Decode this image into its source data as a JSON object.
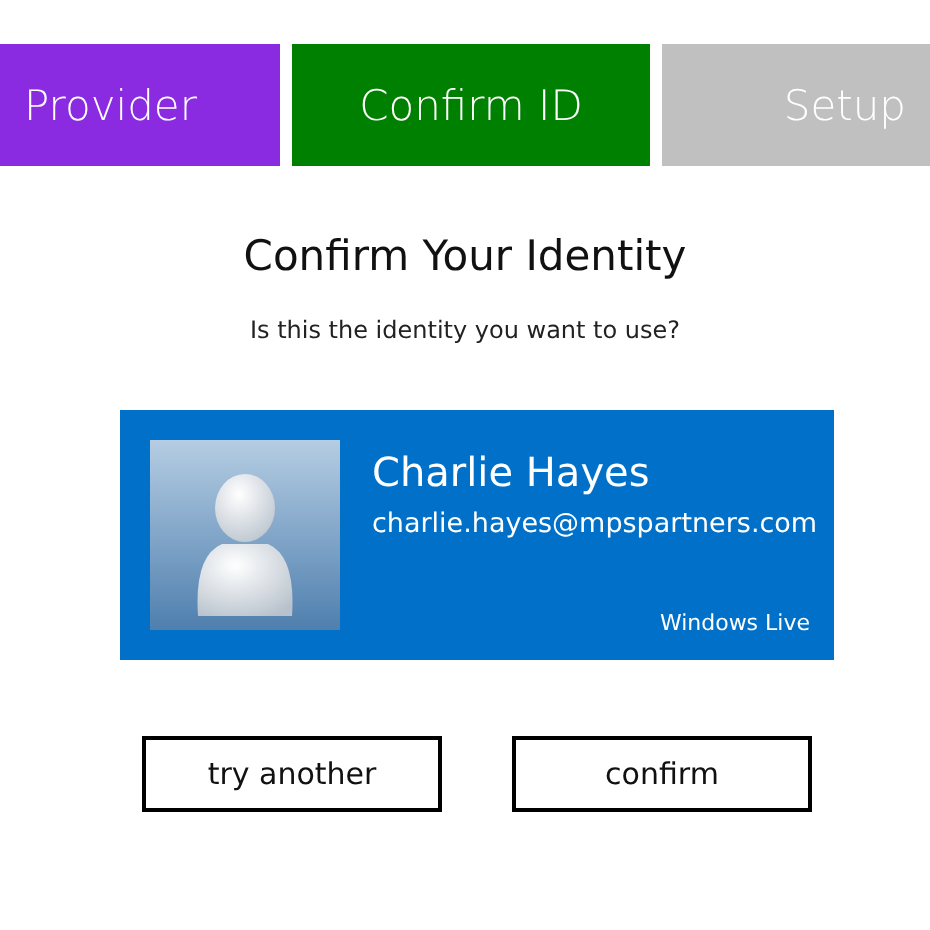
{
  "steps": [
    {
      "label": "Provider",
      "color": "#8a2be2"
    },
    {
      "label": "Confirm ID",
      "color": "#008000"
    },
    {
      "label": "Setup",
      "color": "#c0c0c0"
    }
  ],
  "title": "Confirm Your Identity",
  "subtitle": "Is this the identity you want to use?",
  "identity": {
    "name": "Charlie Hayes",
    "email": "charlie.hayes@mpspartners.com",
    "provider": "Windows Live"
  },
  "buttons": [
    "try another",
    "confirm"
  ]
}
